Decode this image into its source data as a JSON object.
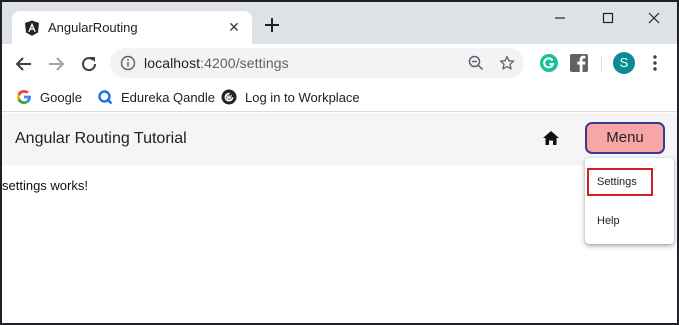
{
  "browser": {
    "tab_title": "AngularRouting",
    "url_host": "localhost",
    "url_rest": ":4200/settings",
    "profile_initial": "S"
  },
  "bookmarks": [
    {
      "label": "Google",
      "icon": "google-icon"
    },
    {
      "label": "Edureka Qandle",
      "icon": "qandle-icon"
    },
    {
      "label": "Log in to Workplace",
      "icon": "workplace-icon"
    }
  ],
  "app": {
    "title": "Angular Routing Tutorial",
    "menu_label": "Menu",
    "content": "settings works!",
    "menu_items": [
      "Settings",
      "Help"
    ]
  },
  "colors": {
    "menu_button_fill": "#f8a5a5",
    "menu_button_border": "#3a3a8c",
    "highlight_border": "#d21f1f",
    "avatar": "#0b8c95"
  }
}
